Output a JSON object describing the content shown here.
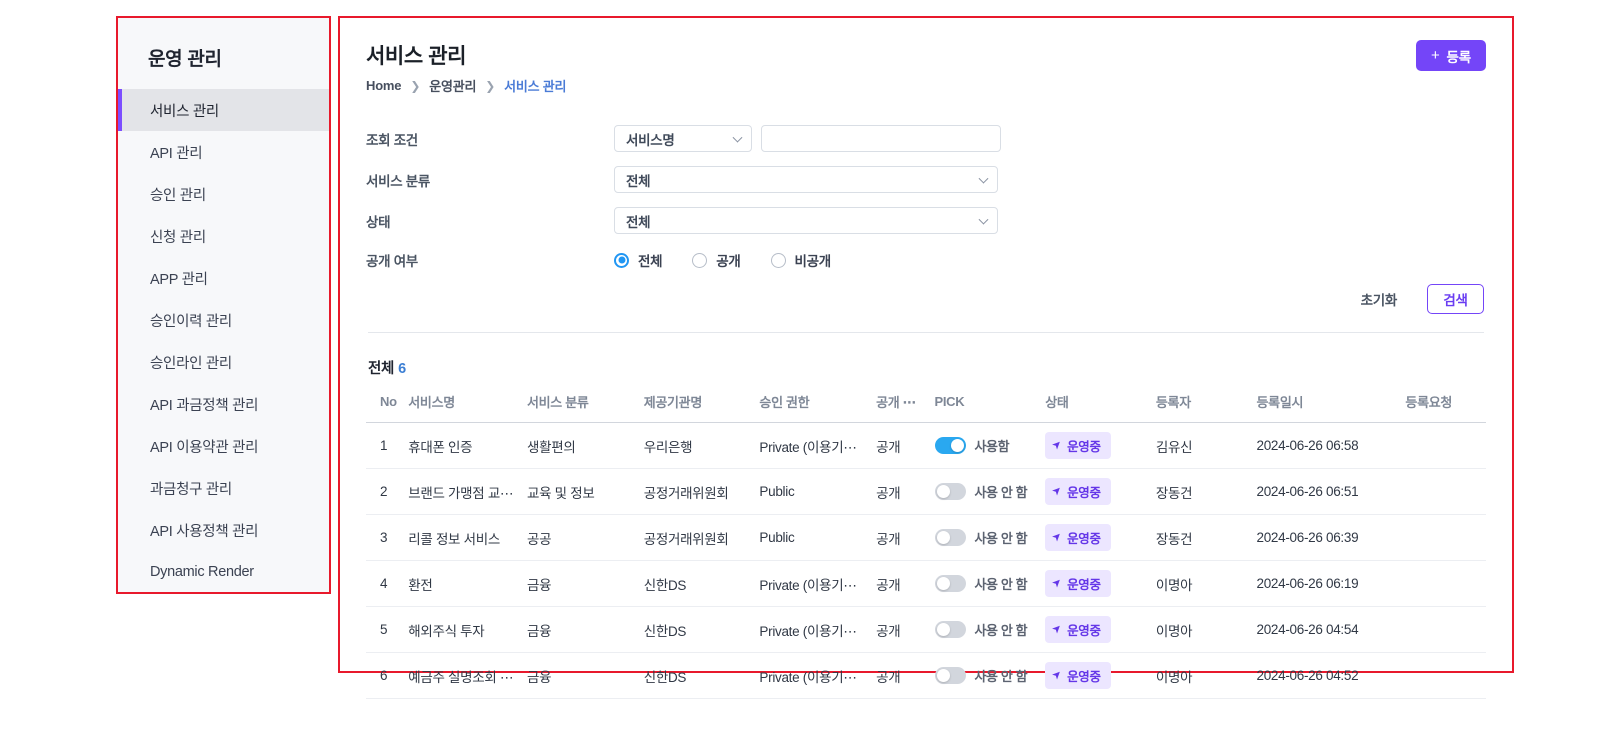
{
  "sidebar": {
    "title": "운영 관리",
    "items": [
      {
        "label": "서비스 관리",
        "active": true
      },
      {
        "label": "API 관리",
        "active": false
      },
      {
        "label": "승인 관리",
        "active": false
      },
      {
        "label": "신청 관리",
        "active": false
      },
      {
        "label": "APP 관리",
        "active": false
      },
      {
        "label": "승인이력 관리",
        "active": false
      },
      {
        "label": "승인라인 관리",
        "active": false
      },
      {
        "label": "API 과금정책 관리",
        "active": false
      },
      {
        "label": "API 이용약관 관리",
        "active": false
      },
      {
        "label": "과금청구 관리",
        "active": false
      },
      {
        "label": "API 사용정책 관리",
        "active": false
      },
      {
        "label": "Dynamic Render",
        "active": false
      }
    ]
  },
  "header": {
    "title": "서비스 관리",
    "breadcrumb": [
      "Home",
      "운영관리",
      "서비스 관리"
    ],
    "separator": "❯",
    "register_label": "등록",
    "register_plus": "+"
  },
  "filters": {
    "condition_label": "조회 조건",
    "condition_value": "서비스명",
    "condition_keyword": "",
    "condition_placeholder": "",
    "category_label": "서비스 분류",
    "category_value": "전체",
    "status_label": "상태",
    "status_value": "전체",
    "visibility_label": "공개 여부",
    "visibility_options": [
      {
        "label": "전체",
        "checked": true
      },
      {
        "label": "공개",
        "checked": false
      },
      {
        "label": "비공개",
        "checked": false
      }
    ],
    "reset_label": "초기화",
    "search_label": "검색"
  },
  "table": {
    "total_label": "전체",
    "total_count": "6",
    "columns": [
      "No",
      "서비스명",
      "서비스 분류",
      "제공기관명",
      "승인 권한",
      "공개 ⋯",
      "PICK",
      "상태",
      "등록자",
      "등록일시",
      "등록요청"
    ],
    "rows": [
      {
        "no": "1",
        "name": "휴대폰 인증",
        "category": "생활편의",
        "org": "우리은행",
        "auth": "Private (이용기⋯",
        "open": "공개",
        "pick_on": true,
        "pick_label": "사용함",
        "state": "운영중",
        "user": "김유신",
        "date": "2024-06-26 06:58",
        "request": ""
      },
      {
        "no": "2",
        "name": "브랜드 가맹점 교⋯",
        "category": "교육 및 정보",
        "org": "공정거래위원회",
        "auth": "Public",
        "open": "공개",
        "pick_on": false,
        "pick_label": "사용 안 함",
        "state": "운영중",
        "user": "장동건",
        "date": "2024-06-26 06:51",
        "request": ""
      },
      {
        "no": "3",
        "name": "리콜 정보 서비스",
        "category": "공공",
        "org": "공정거래위원회",
        "auth": "Public",
        "open": "공개",
        "pick_on": false,
        "pick_label": "사용 안 함",
        "state": "운영중",
        "user": "장동건",
        "date": "2024-06-26 06:39",
        "request": ""
      },
      {
        "no": "4",
        "name": "환전",
        "category": "금융",
        "org": "신한DS",
        "auth": "Private (이용기⋯",
        "open": "공개",
        "pick_on": false,
        "pick_label": "사용 안 함",
        "state": "운영중",
        "user": "이명아",
        "date": "2024-06-26 06:19",
        "request": ""
      },
      {
        "no": "5",
        "name": "해외주식 투자",
        "category": "금융",
        "org": "신한DS",
        "auth": "Private (이용기⋯",
        "open": "공개",
        "pick_on": false,
        "pick_label": "사용 안 함",
        "state": "운영중",
        "user": "이명아",
        "date": "2024-06-26 04:54",
        "request": ""
      },
      {
        "no": "6",
        "name": "예금주 실명조회 ⋯",
        "category": "금융",
        "org": "신한DS",
        "auth": "Private (이용기⋯",
        "open": "공개",
        "pick_on": false,
        "pick_label": "사용 안 함",
        "state": "운영중",
        "user": "이명아",
        "date": "2024-06-26 04:52",
        "request": ""
      }
    ]
  },
  "colors": {
    "accent_purple": "#7445f8",
    "badge_bg": "#ece6ff",
    "badge_text": "#6436e8",
    "toggle_on": "#2aa8f0",
    "link_blue": "#4a7bd6",
    "outline_red": "#e8192c"
  },
  "icons": {
    "rocket": "➤",
    "plus": "+",
    "chevron": "v"
  }
}
